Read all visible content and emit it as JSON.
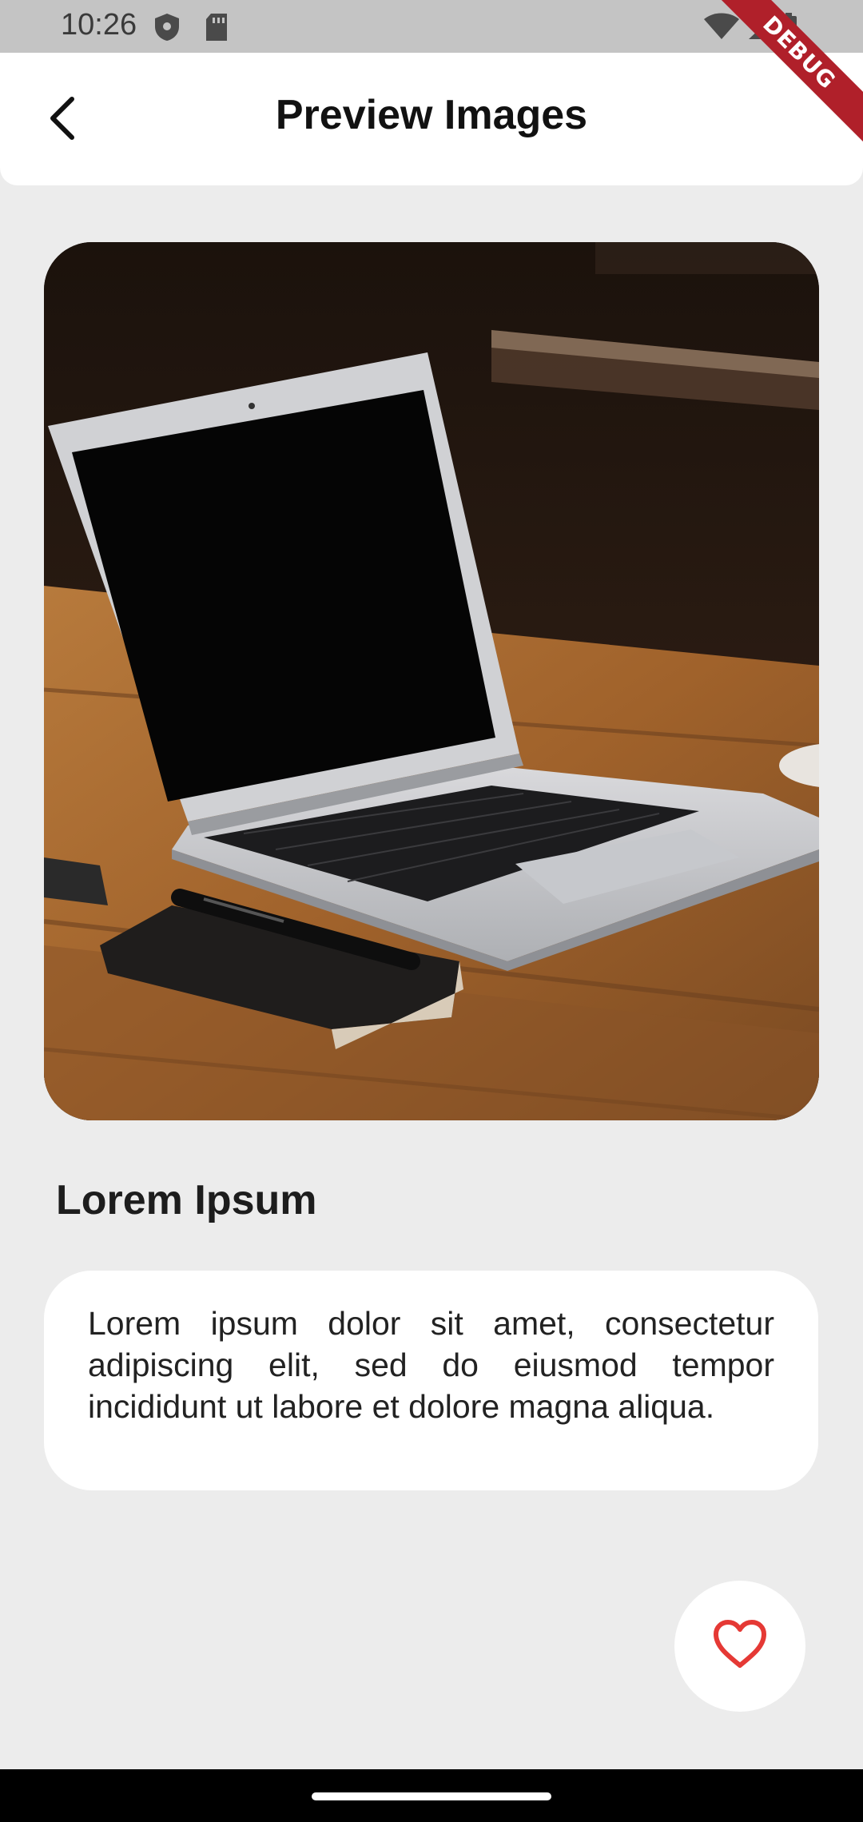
{
  "status_bar": {
    "time": "10:26",
    "icons": [
      "shield-icon",
      "sd-card-icon",
      "wifi-icon",
      "signal-icon",
      "battery-icon"
    ]
  },
  "debug_banner": {
    "label": "DEBUG"
  },
  "app_bar": {
    "title": "Preview Images",
    "back_icon": "chevron-left-icon"
  },
  "preview": {
    "image_subject": "laptop-on-wooden-table"
  },
  "item": {
    "title": "Lorem Ipsum",
    "description": "Lorem ipsum dolor sit amet, consectetur adipiscing elit, sed do eiusmod tempor incididunt ut labore et dolore magna aliqua."
  },
  "favorite": {
    "icon": "heart-outline-icon",
    "color": "#e53935"
  },
  "colors": {
    "background": "#ececec",
    "surface": "#ffffff",
    "status_bar": "#c4c4c4",
    "debug_ribbon": "#b0202a"
  }
}
